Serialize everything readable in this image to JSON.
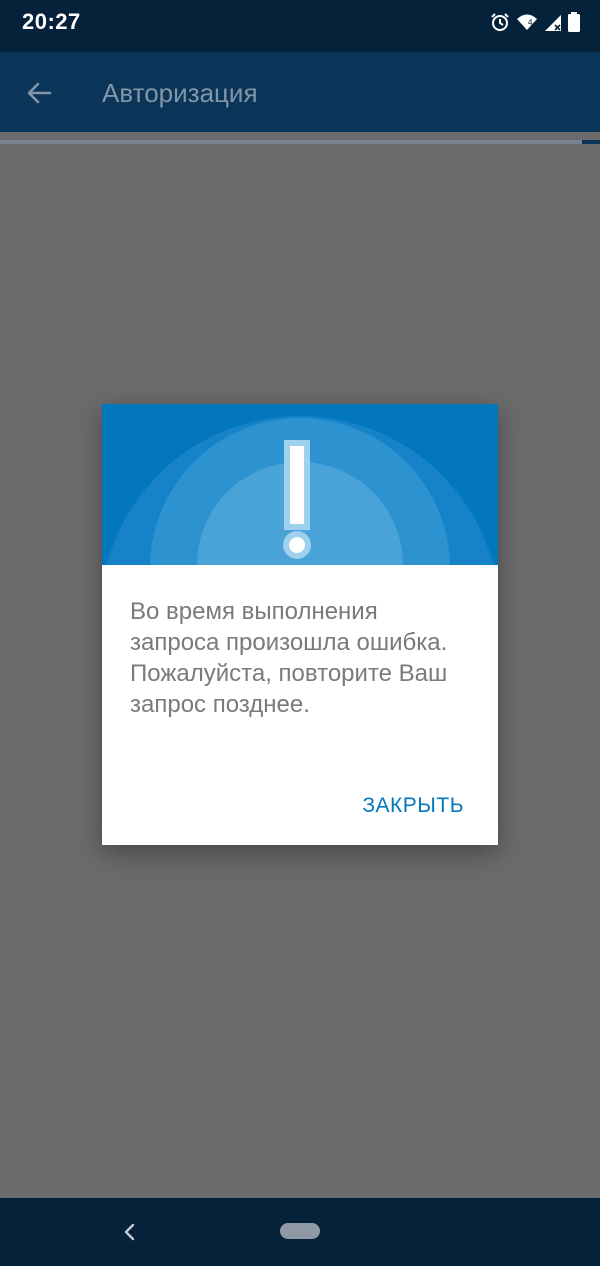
{
  "status_bar": {
    "time": "20:27",
    "icons": [
      "alarm-icon",
      "wifi-icon",
      "signal-icon",
      "battery-icon"
    ]
  },
  "app_bar": {
    "title": "Авторизация",
    "back_icon": "arrow-back-icon"
  },
  "dialog": {
    "header_icon": "exclamation-icon",
    "message": "Во время выполнения запроса произошла ошибка. Пожалуйста, повторите Ваш запрос позднее.",
    "close_label": "ЗАКРЫТЬ"
  },
  "nav_bar": {
    "back_icon": "nav-back-icon",
    "home_icon": "nav-home-pill"
  },
  "colors": {
    "status_bar": "#06213a",
    "accent": "#0277bd",
    "overlay": "#6b6b6b",
    "message_text": "#7a7a7a"
  }
}
